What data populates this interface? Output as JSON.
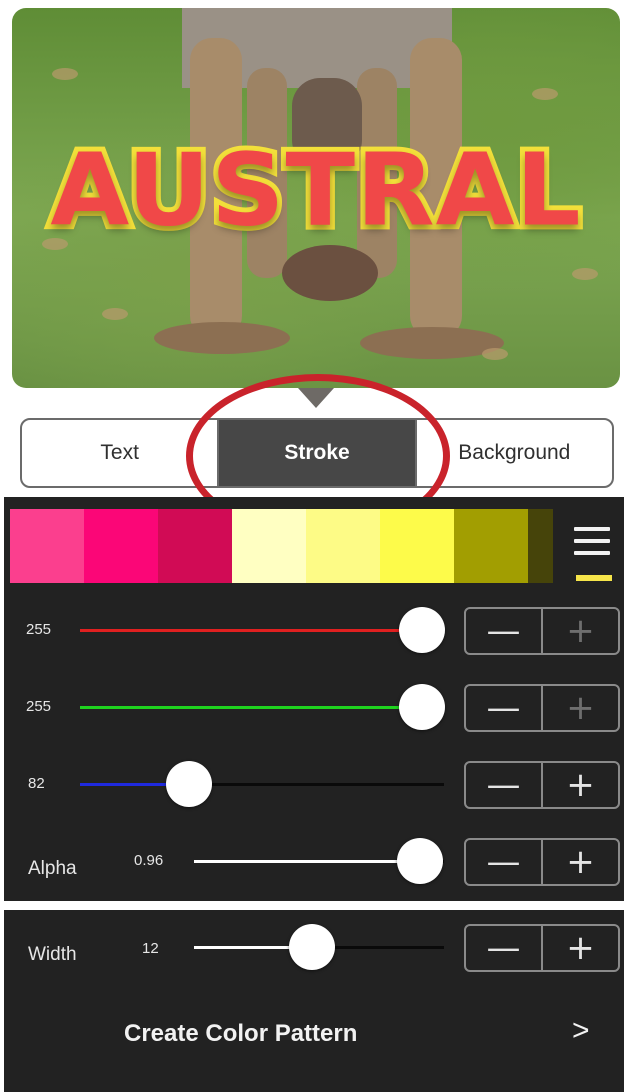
{
  "preview": {
    "title_text": "AUSTRAL",
    "colors": {
      "fill": "#f04848",
      "stroke": "#f3e03a"
    }
  },
  "tabs": [
    {
      "label": "Text",
      "active": false
    },
    {
      "label": "Stroke",
      "active": true
    },
    {
      "label": "Background",
      "active": false
    }
  ],
  "palette": {
    "swatches": [
      "#fb3f8e",
      "#fb0677",
      "#d10b55",
      "#ffffc2",
      "#fdfb86",
      "#fdfb4a",
      "#a29e01",
      "#46440a"
    ],
    "menu_icon": "hamburger-icon",
    "selected_indicator_color": "#f6e54a"
  },
  "sliders": {
    "red": {
      "value": "255",
      "fraction": 1.0,
      "color": "#e02020"
    },
    "green": {
      "value": "255",
      "fraction": 1.0,
      "color": "#1fd31f"
    },
    "blue": {
      "value": "82",
      "fraction": 0.32,
      "color": "#1f2adf"
    },
    "alpha": {
      "label": "Alpha",
      "value": "0.96",
      "fraction": 0.96,
      "color": "#ffffff"
    },
    "width": {
      "label": "Width",
      "value": "12",
      "fraction": 0.5,
      "color": "#ffffff"
    }
  },
  "stepper": {
    "minus": "—",
    "plus": "+"
  },
  "pattern": {
    "label": "Create Color Pattern",
    "chevron": ">"
  }
}
